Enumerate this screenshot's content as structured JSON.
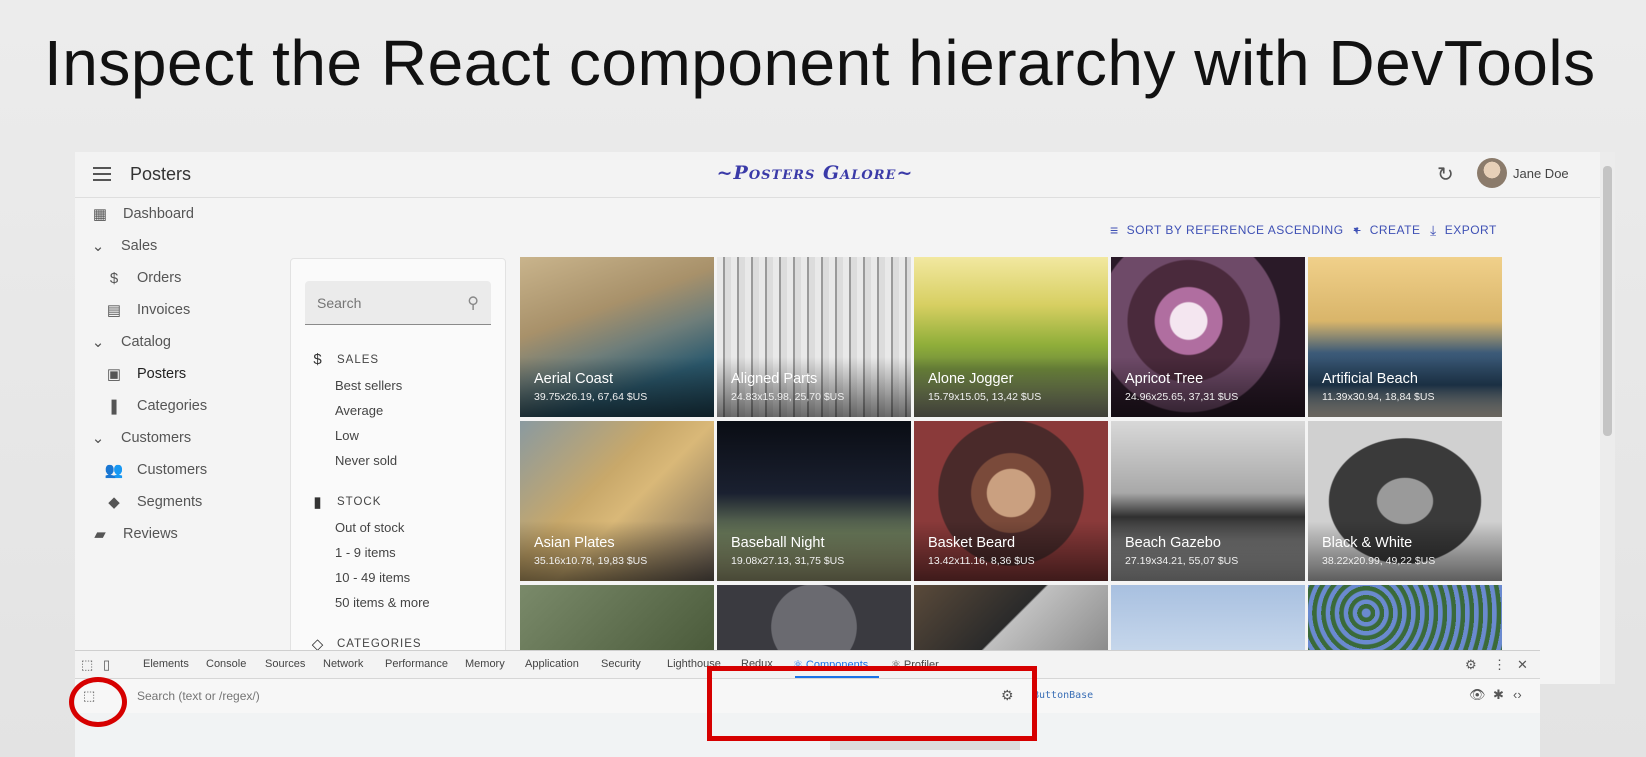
{
  "slide": {
    "title": "Inspect the React component hierarchy with DevTools"
  },
  "appbar": {
    "title": "Posters",
    "brand": "~Posters Galore~",
    "user": "Jane Doe"
  },
  "sidebar": {
    "items": [
      {
        "label": "Dashboard",
        "icon": "dashboard-icon"
      },
      {
        "label": "Sales",
        "icon": "chevron-down-icon"
      },
      {
        "label": "Orders",
        "icon": "dollar-icon"
      },
      {
        "label": "Invoices",
        "icon": "invoice-icon"
      },
      {
        "label": "Catalog",
        "icon": "chevron-down-icon"
      },
      {
        "label": "Posters",
        "icon": "image-icon"
      },
      {
        "label": "Categories",
        "icon": "bookmark-icon"
      },
      {
        "label": "Customers",
        "icon": "chevron-down-icon"
      },
      {
        "label": "Customers",
        "icon": "people-icon"
      },
      {
        "label": "Segments",
        "icon": "label-icon"
      },
      {
        "label": "Reviews",
        "icon": "comment-icon"
      }
    ]
  },
  "filters": {
    "search_placeholder": "Search",
    "sales_heading": "SALES",
    "sales_items": [
      "Best sellers",
      "Average",
      "Low",
      "Never sold"
    ],
    "stock_heading": "STOCK",
    "stock_items": [
      "Out of stock",
      "1 - 9 items",
      "10 - 49 items",
      "50 items & more"
    ],
    "categories_heading": "CATEGORIES"
  },
  "toolbar": {
    "sort_label": "SORT BY REFERENCE ASCENDING",
    "create_label": "CREATE",
    "export_label": "EXPORT"
  },
  "posters": [
    {
      "name": "Aerial Coast",
      "meta": "39.75x26.19, 67,64 $US"
    },
    {
      "name": "Aligned Parts",
      "meta": "24.83x15.98, 25,70 $US"
    },
    {
      "name": "Alone Jogger",
      "meta": "15.79x15.05, 13,42 $US"
    },
    {
      "name": "Apricot Tree",
      "meta": "24.96x25.65, 37,31 $US"
    },
    {
      "name": "Artificial Beach",
      "meta": "11.39x30.94, 18,84 $US"
    },
    {
      "name": "Asian Plates",
      "meta": "35.16x10.78, 19,83 $US"
    },
    {
      "name": "Baseball Night",
      "meta": "19.08x27.13, 31,75 $US"
    },
    {
      "name": "Basket Beard",
      "meta": "13.42x11.16, 8,36 $US"
    },
    {
      "name": "Beach Gazebo",
      "meta": "27.19x34.21, 55,07 $US"
    },
    {
      "name": "Black & White",
      "meta": "38.22x20.99, 49,22 $US"
    }
  ],
  "devtools": {
    "tabs": [
      "Elements",
      "Console",
      "Sources",
      "Network",
      "Performance",
      "Memory",
      "Application",
      "Security",
      "Lighthouse",
      "Redux",
      "Components",
      "Profiler"
    ],
    "active_tab": "Components",
    "search_placeholder": "Search (text or /regex/)",
    "selected_component": "ButtonBase"
  },
  "colors": {
    "accent": "#3f51b5",
    "devtools_active": "#1a73e8",
    "highlight_red": "#d60000"
  }
}
